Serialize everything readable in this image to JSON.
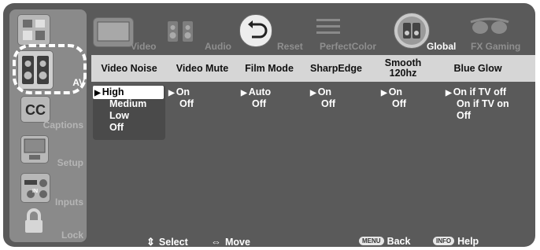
{
  "categories": [
    {
      "name": "picture",
      "label": "",
      "icon": "picture-category-icon"
    },
    {
      "name": "av",
      "label": "AV",
      "icon": "speakers-icon",
      "active": true
    },
    {
      "name": "captions",
      "label": "Captions",
      "icon": "cc-icon"
    },
    {
      "name": "setup",
      "label": "Setup",
      "icon": "computer-icon"
    },
    {
      "name": "inputs",
      "label": "Inputs",
      "icon": "input-jacks-icon"
    },
    {
      "name": "lock",
      "label": "Lock",
      "icon": "padlock-icon"
    }
  ],
  "submenu": [
    {
      "label": "Video",
      "icon": "tv-icon"
    },
    {
      "label": "Audio",
      "icon": "speaker-icon"
    },
    {
      "label": "Reset",
      "icon": "reset-icon"
    },
    {
      "label": "PerfectColor",
      "icon": "color-bars-icon"
    },
    {
      "label": "Global",
      "icon": "globe-speaker-icon",
      "active": true
    },
    {
      "label": "FX Gaming",
      "icon": "3d-glasses-icon"
    }
  ],
  "columns": [
    {
      "title": "Video Noise",
      "options": [
        "High",
        "Medium",
        "Low",
        "Off"
      ],
      "selected": "High"
    },
    {
      "title": "Video Mute",
      "options": [
        "On",
        "Off"
      ],
      "selected": "On"
    },
    {
      "title": "Film Mode",
      "options": [
        "Auto",
        "Off"
      ],
      "selected": "Auto"
    },
    {
      "title": "SharpEdge",
      "options": [
        "On",
        "Off"
      ],
      "selected": "On"
    },
    {
      "title": "Smooth 120hz",
      "title_line1": "Smooth",
      "title_line2": "120hz",
      "options": [
        "On",
        "Off"
      ],
      "selected": "On"
    },
    {
      "title": "Blue Glow",
      "options": [
        "On if TV off",
        "On if TV on",
        "Off"
      ],
      "selected": "On if TV off"
    }
  ],
  "hints": {
    "select": "Select",
    "move": "Move",
    "back_key": "MENU",
    "back": "Back",
    "help_key": "INFO",
    "help": "Help"
  }
}
